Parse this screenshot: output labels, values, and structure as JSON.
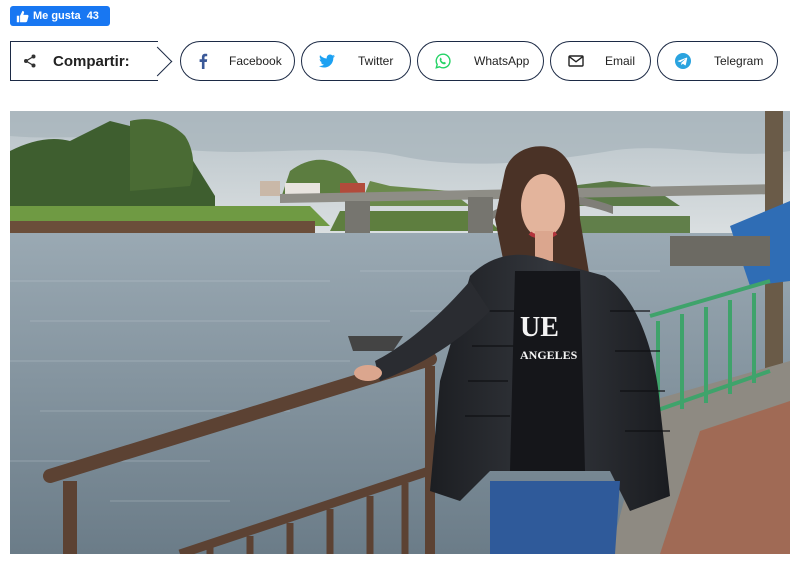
{
  "like": {
    "label": "Me gusta",
    "count": "43",
    "icon": "thumbs-up-icon"
  },
  "share": {
    "label": "Compartir:",
    "icon": "share-icon",
    "buttons": [
      {
        "label": "Facebook",
        "icon": "facebook-icon",
        "color": "#3b5998"
      },
      {
        "label": "Twitter",
        "icon": "twitter-icon",
        "color": "#1da1f2"
      },
      {
        "label": "WhatsApp",
        "icon": "whatsapp-icon",
        "color": "#25d366"
      },
      {
        "label": "Email",
        "icon": "email-icon",
        "color": "#222222"
      },
      {
        "label": "Telegram",
        "icon": "telegram-icon",
        "color": "#2aa3df"
      }
    ]
  },
  "photo": {
    "jacket_text_line1": "UE",
    "jacket_text_line2": "ANGELES"
  }
}
